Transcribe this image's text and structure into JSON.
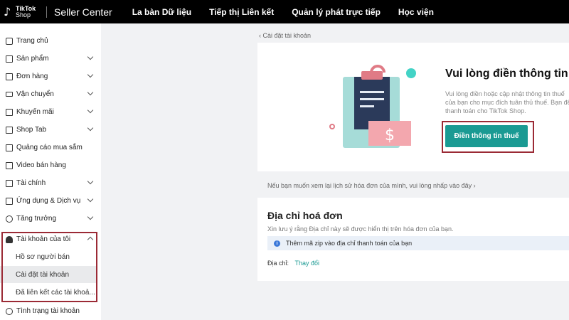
{
  "topbar": {
    "logo_line1": "TikTok",
    "logo_line2": "Shop",
    "app_title": "Seller Center",
    "nav": [
      "La bàn Dữ liệu",
      "Tiếp thị Liên kết",
      "Quản lý phát trực tiếp",
      "Học viện"
    ]
  },
  "sidebar": {
    "items": [
      {
        "label": "Trang chủ",
        "icon": "home-icon"
      },
      {
        "label": "Sản phẩm",
        "icon": "box-icon"
      },
      {
        "label": "Đơn hàng",
        "icon": "order-icon"
      },
      {
        "label": "Vận chuyển",
        "icon": "truck-icon"
      },
      {
        "label": "Khuyến mãi",
        "icon": "promotion-icon"
      },
      {
        "label": "Shop Tab",
        "icon": "shop-tab-icon"
      },
      {
        "label": "Quảng cáo mua sắm",
        "icon": "ads-icon"
      },
      {
        "label": "Video bán hàng",
        "icon": "video-icon"
      },
      {
        "label": "Tài chính",
        "icon": "finance-icon"
      },
      {
        "label": "Ứng dụng & Dịch vụ",
        "icon": "apps-icon"
      },
      {
        "label": "Tăng trưởng",
        "icon": "growth-icon"
      },
      {
        "label": "Tài khoản của tôi",
        "icon": "account-icon"
      },
      {
        "label": "Tình trạng tài khoản",
        "icon": "shield-icon"
      }
    ],
    "sub_items": [
      "Hồ sơ người bán",
      "Cài đặt tài khoản",
      "Đã liên kết các tài khoả..."
    ]
  },
  "main": {
    "breadcrumb": "‹  Cài đặt tài khoản",
    "tax_card": {
      "title": "Vui lòng điền thông tin",
      "description": "Vui lòng điền hoặc cập nhật thông tin thuế của bạn cho mục đích tuân thủ thuế. Bạn để thanh toán cho TikTok Shop.",
      "button": "Điền thông tin thuế"
    },
    "history_link": "Nếu bạn muốn xem lại lịch sử hóa đơn của mình, vui lòng nhấp vào đây ›",
    "address_card": {
      "title": "Địa chỉ hoá đơn",
      "note": "Xin lưu ý rằng Địa chỉ này sẽ được hiển thị trên hóa đơn của bạn.",
      "info": "Thêm mã zip vào địa chỉ thanh toán của bạn",
      "address_label": "Địa chỉ:",
      "change_link": "Thay đổi"
    }
  },
  "colors": {
    "accent": "#1a9a93",
    "highlight": "#9b2a35",
    "topbar": "#000000"
  }
}
